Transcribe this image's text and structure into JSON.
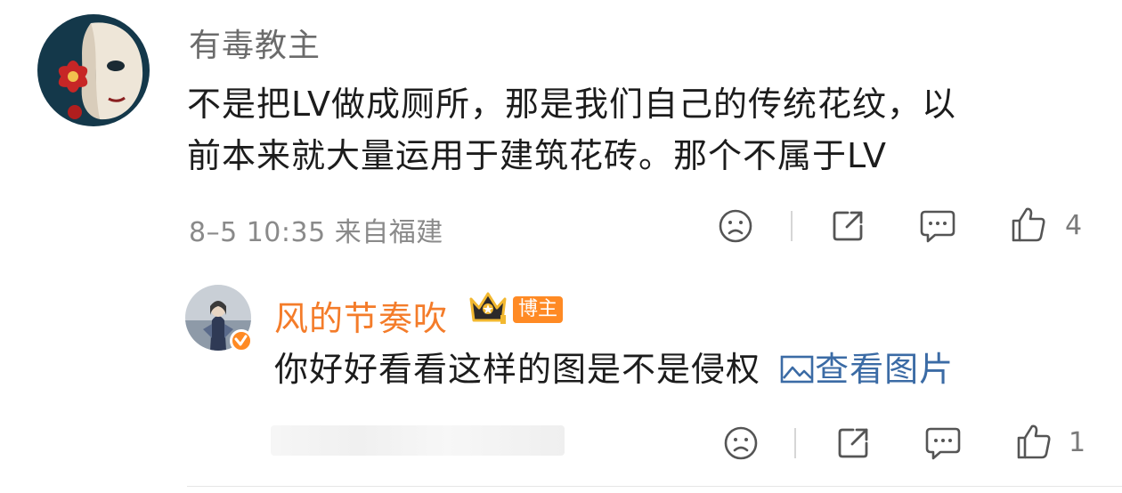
{
  "comment": {
    "username": "有毒教主",
    "text_line1": "不是把LV做成厕所，那是我们自己的传统花纹，以",
    "text_line2": "前本来就大量运用于建筑花砖。那个不属于LV",
    "meta": "8–5 10:35 来自福建",
    "like_count": "4"
  },
  "reply": {
    "username": "风的节奏吹",
    "badge_label": "博主",
    "text": "你好好看看这样的图是不是侵权",
    "link_label": "查看图片",
    "like_count": "1"
  },
  "icons": {
    "dislike": "sad-face-icon",
    "share": "share-icon",
    "comment": "comment-bubble-icon",
    "like": "thumbs-up-icon",
    "crown": "crown-icon",
    "verified": "verified-badge-icon",
    "image": "image-icon"
  },
  "colors": {
    "accent_orange": "#f47c2a",
    "link_blue": "#3b6ba5",
    "meta_gray": "#8a8a8a"
  }
}
